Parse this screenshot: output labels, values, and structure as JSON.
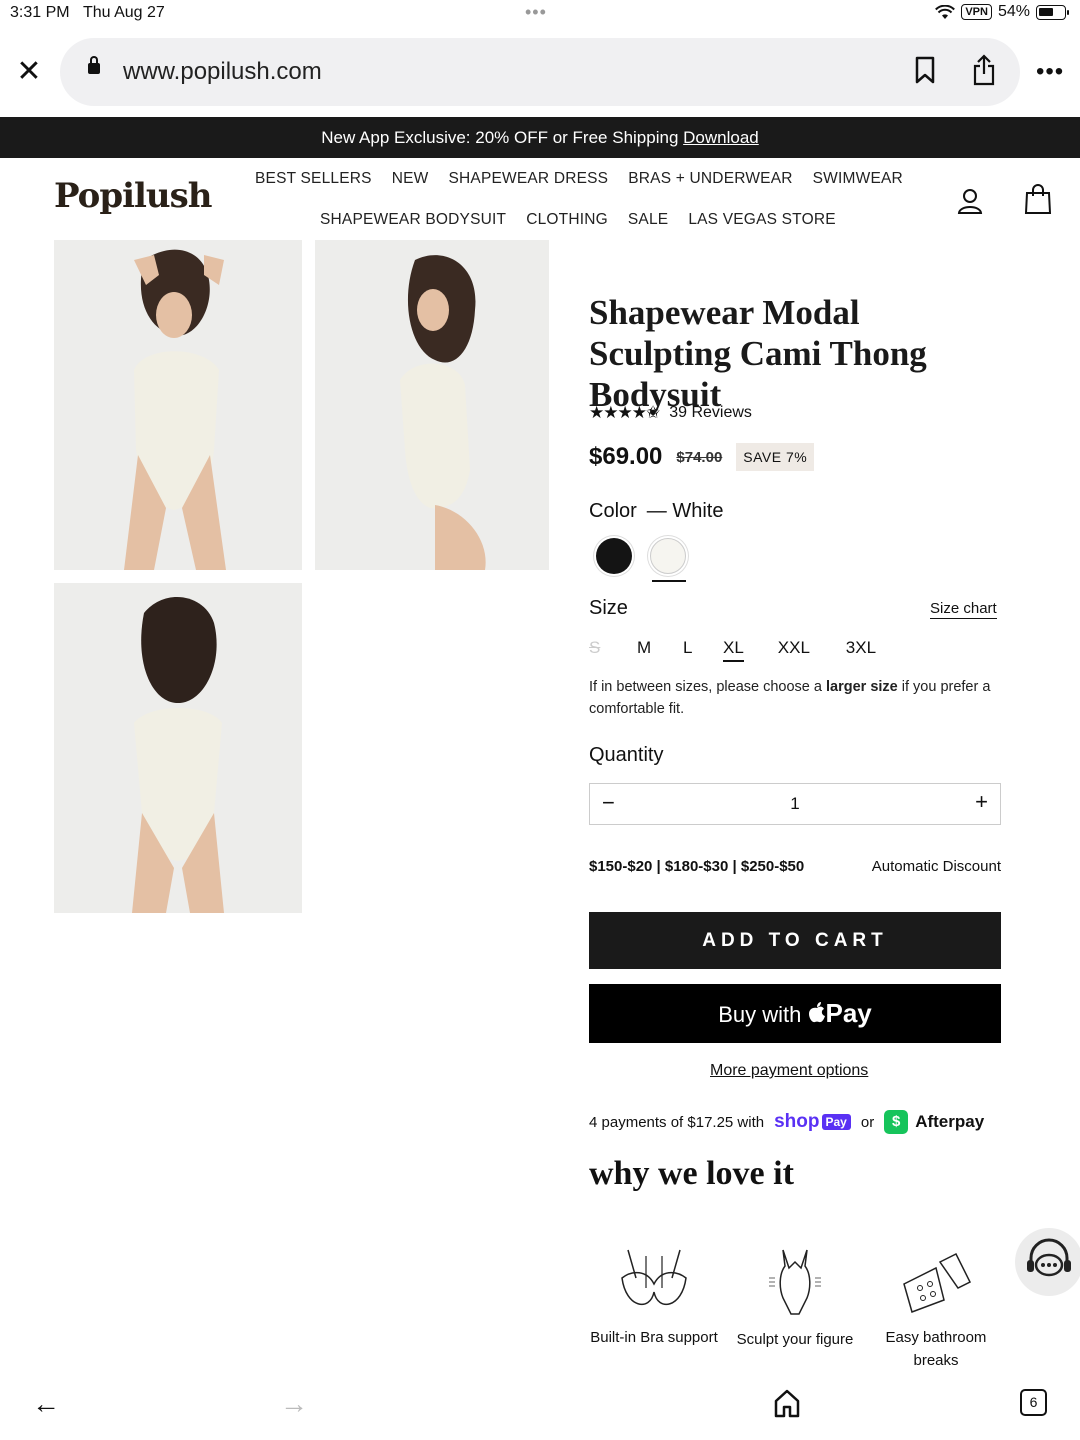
{
  "status_bar": {
    "time": "3:31 PM",
    "date": "Thu Aug 27",
    "vpn": "VPN",
    "battery": "54%"
  },
  "browser": {
    "url": "www.popilush.com"
  },
  "promo": {
    "text": "New App Exclusive: 20% OFF or Free Shipping",
    "link": "Download"
  },
  "header": {
    "logo": "Popilush",
    "nav_row1": [
      "BEST SELLERS",
      "NEW",
      "SHAPEWEAR DRESS",
      "BRAS + UNDERWEAR",
      "SWIMWEAR"
    ],
    "nav_row2": [
      "SHAPEWEAR BODYSUIT",
      "CLOTHING",
      "SALE",
      "LAS VEGAS STORE"
    ]
  },
  "product": {
    "title": "Shapewear Modal Sculpting Cami Thong Bodysuit",
    "rating": 4.5,
    "reviews": "39 Reviews",
    "price": "$69.00",
    "compare_price": "$74.00",
    "save": "SAVE 7%",
    "color_label": "Color",
    "color_value": "— White",
    "colors": [
      {
        "name": "Black",
        "hex": "#141414"
      },
      {
        "name": "White",
        "hex": "#f6f5f0",
        "selected": true
      }
    ],
    "size_label": "Size",
    "size_chart": "Size chart",
    "sizes": [
      "S",
      "M",
      "L",
      "XL",
      "XXL",
      "3XL"
    ],
    "selected_size": "XL",
    "size_note_1": "If in between sizes, please choose a",
    "size_note_bold": "larger size",
    "size_note_2": "if you prefer a comfortable fit.",
    "quantity_label": "Quantity",
    "quantity": "1",
    "discount_tiers": "$150-$20 | $180-$30 | $250-$50",
    "discount_note": "Automatic Discount",
    "add_to_cart": "ADD TO CART",
    "apple_pay_prefix": "Buy with",
    "apple_pay_brand": "Pay",
    "more_payment": "More payment options",
    "installments": "4 payments of $17.25 with",
    "shop_pay": "shop",
    "shop_pay_badge": "Pay",
    "or": "or",
    "afterpay": "Afterpay"
  },
  "why": {
    "heading": "why we love it",
    "features": [
      {
        "label": "Built-in Bra support",
        "icon": "bra-icon"
      },
      {
        "label": "Sculpt your figure",
        "icon": "bodysuit-icon"
      },
      {
        "label": "Easy bathroom breaks",
        "icon": "snap-closure-icon"
      }
    ]
  },
  "toolbar": {
    "tabs_count": "6"
  }
}
